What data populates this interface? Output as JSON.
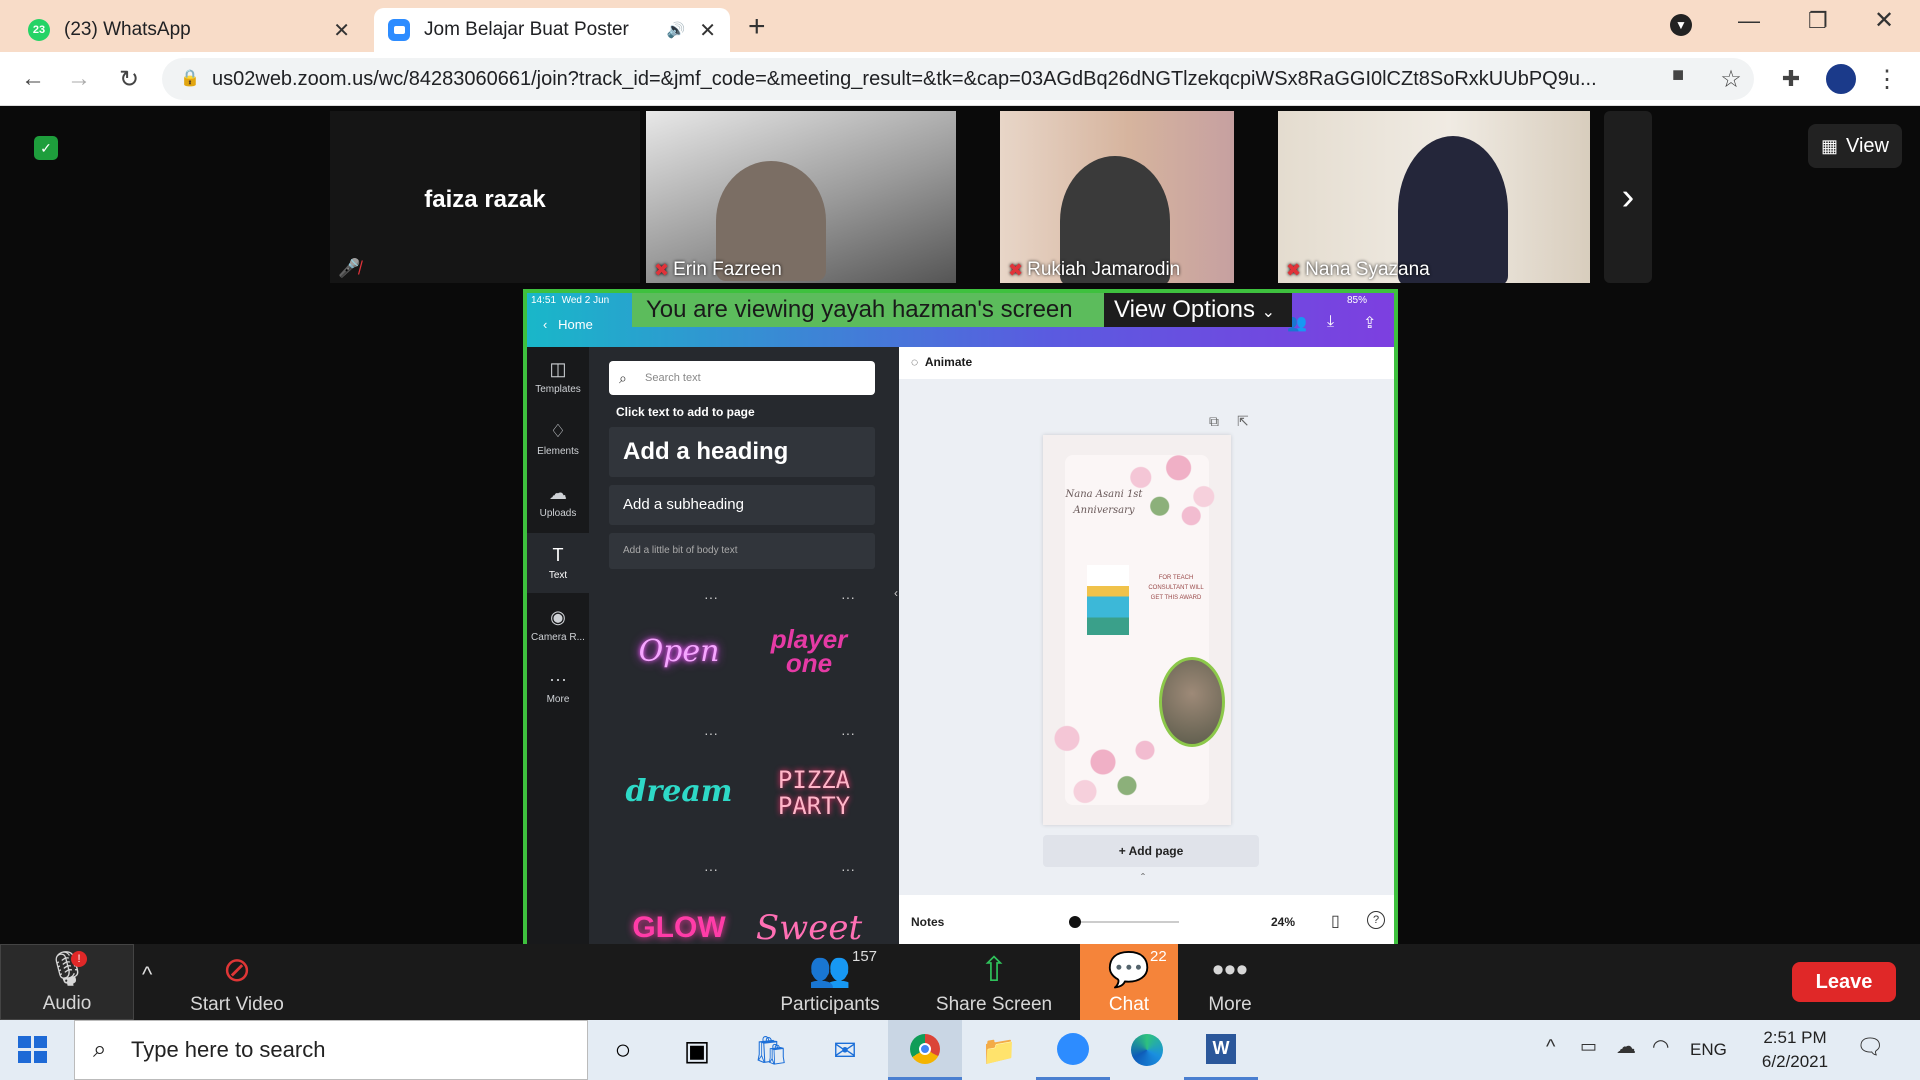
{
  "browser": {
    "tabs": [
      {
        "badge": "23",
        "title": "(23) WhatsApp",
        "icon": "whatsapp-icon"
      },
      {
        "title": "Jom Belajar Buat Poster",
        "icon": "zoom-icon"
      }
    ],
    "url": "us02web.zoom.us/wc/84283060661/join?track_id=&jmf_code=&meeting_result=&tk=&cap=03AGdBq26dNGTlzekqcpiWSx8RaGGI0lCZt8SoRxkUUbPQ9u..."
  },
  "zoom": {
    "view_label": "View",
    "participants_top": [
      {
        "name": "faiza razak"
      },
      {
        "name": "Erin Fazreen"
      },
      {
        "name": "Rukiah Jamarodin"
      },
      {
        "name": "Nana Syazana"
      }
    ],
    "share_banner": "You are viewing yayah hazman's screen",
    "view_options": "View Options",
    "toolbar": {
      "audio": "Audio",
      "start_video": "Start Video",
      "participants": "Participants",
      "participants_count": "157",
      "share_screen": "Share Screen",
      "chat": "Chat",
      "chat_count": "22",
      "more": "More",
      "leave": "Leave"
    }
  },
  "canva": {
    "status_time": "14:51",
    "status_date": "Wed 2 Jun",
    "battery": "85%",
    "home": "Home",
    "rail": [
      "Templates",
      "Elements",
      "Uploads",
      "Text",
      "Camera R...",
      "More"
    ],
    "search_placeholder": "Search text",
    "click_text": "Click text to add to page",
    "heading": "Add a heading",
    "subheading": "Add a subheading",
    "body_text": "Add a little bit of body text",
    "styles": [
      "Open",
      "player one",
      "dream",
      "PIZZA PARTY",
      "GLOW",
      "Sweet"
    ],
    "animate": "Animate",
    "poster_title": "Nana Asani 1st Anniversary",
    "poster_body": "FOR TEACH CONSULTANT WILL GET THIS AWARD",
    "add_page": "+ Add page",
    "notes": "Notes",
    "zoom_pct": "24%"
  },
  "taskbar": {
    "search_placeholder": "Type here to search",
    "lang": "ENG",
    "time": "2:51 PM",
    "date": "6/2/2021"
  },
  "colors": {
    "share_border": "#3ec13e",
    "leave": "#e02828",
    "chat_active": "#f5843a",
    "banner": "#5cbc5c"
  }
}
